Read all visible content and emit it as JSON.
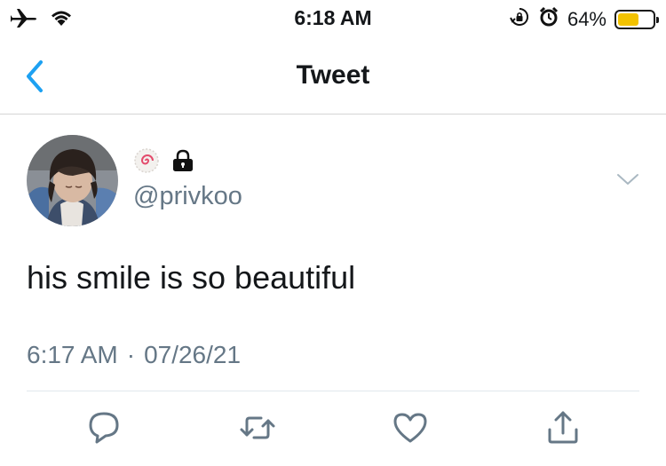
{
  "status_bar": {
    "time": "6:18 AM",
    "battery_percent": "64%",
    "battery_level": 0.64,
    "icons": [
      "airplane-icon",
      "wifi-icon",
      "orientation-lock-icon",
      "alarm-icon",
      "battery-icon"
    ]
  },
  "nav": {
    "title": "Tweet",
    "back_icon": "chevron-left-icon"
  },
  "tweet": {
    "handle": "@privkoo",
    "text": "his smile is so beautiful",
    "time": "6:17 AM",
    "separator": "·",
    "date": "07/26/21",
    "badge_icons": [
      "swirl-emoji-icon",
      "lock-icon"
    ],
    "menu_icon": "chevron-down-icon"
  },
  "actions": {
    "icons": [
      "reply-icon",
      "retweet-icon",
      "like-icon",
      "share-icon"
    ]
  },
  "colors": {
    "accent": "#1da1f2",
    "secondary_text": "#657786",
    "primary_text": "#14171a",
    "divider": "#e1e8ed",
    "battery_fill": "#f2c200"
  }
}
